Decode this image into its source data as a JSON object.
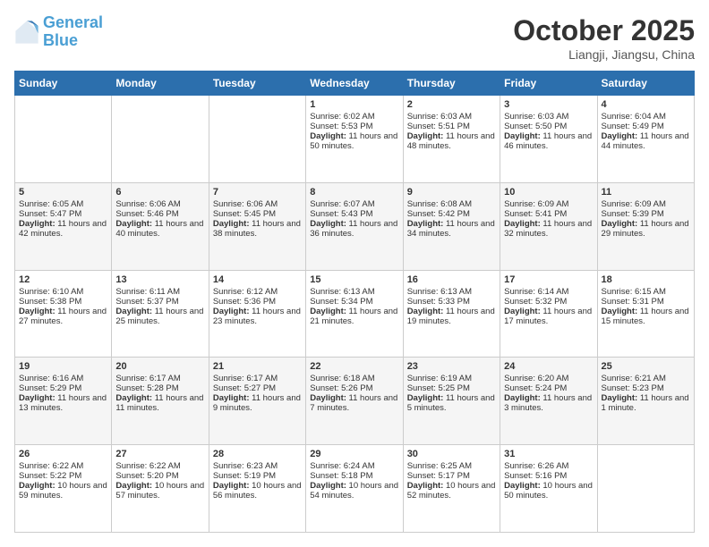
{
  "header": {
    "logo_line1": "General",
    "logo_line2": "Blue",
    "month": "October 2025",
    "location": "Liangji, Jiangsu, China"
  },
  "weekdays": [
    "Sunday",
    "Monday",
    "Tuesday",
    "Wednesday",
    "Thursday",
    "Friday",
    "Saturday"
  ],
  "weeks": [
    [
      {
        "day": "",
        "text": ""
      },
      {
        "day": "",
        "text": ""
      },
      {
        "day": "",
        "text": ""
      },
      {
        "day": "1",
        "text": "Sunrise: 6:02 AM\nSunset: 5:53 PM\nDaylight: 11 hours and 50 minutes."
      },
      {
        "day": "2",
        "text": "Sunrise: 6:03 AM\nSunset: 5:51 PM\nDaylight: 11 hours and 48 minutes."
      },
      {
        "day": "3",
        "text": "Sunrise: 6:03 AM\nSunset: 5:50 PM\nDaylight: 11 hours and 46 minutes."
      },
      {
        "day": "4",
        "text": "Sunrise: 6:04 AM\nSunset: 5:49 PM\nDaylight: 11 hours and 44 minutes."
      }
    ],
    [
      {
        "day": "5",
        "text": "Sunrise: 6:05 AM\nSunset: 5:47 PM\nDaylight: 11 hours and 42 minutes."
      },
      {
        "day": "6",
        "text": "Sunrise: 6:06 AM\nSunset: 5:46 PM\nDaylight: 11 hours and 40 minutes."
      },
      {
        "day": "7",
        "text": "Sunrise: 6:06 AM\nSunset: 5:45 PM\nDaylight: 11 hours and 38 minutes."
      },
      {
        "day": "8",
        "text": "Sunrise: 6:07 AM\nSunset: 5:43 PM\nDaylight: 11 hours and 36 minutes."
      },
      {
        "day": "9",
        "text": "Sunrise: 6:08 AM\nSunset: 5:42 PM\nDaylight: 11 hours and 34 minutes."
      },
      {
        "day": "10",
        "text": "Sunrise: 6:09 AM\nSunset: 5:41 PM\nDaylight: 11 hours and 32 minutes."
      },
      {
        "day": "11",
        "text": "Sunrise: 6:09 AM\nSunset: 5:39 PM\nDaylight: 11 hours and 29 minutes."
      }
    ],
    [
      {
        "day": "12",
        "text": "Sunrise: 6:10 AM\nSunset: 5:38 PM\nDaylight: 11 hours and 27 minutes."
      },
      {
        "day": "13",
        "text": "Sunrise: 6:11 AM\nSunset: 5:37 PM\nDaylight: 11 hours and 25 minutes."
      },
      {
        "day": "14",
        "text": "Sunrise: 6:12 AM\nSunset: 5:36 PM\nDaylight: 11 hours and 23 minutes."
      },
      {
        "day": "15",
        "text": "Sunrise: 6:13 AM\nSunset: 5:34 PM\nDaylight: 11 hours and 21 minutes."
      },
      {
        "day": "16",
        "text": "Sunrise: 6:13 AM\nSunset: 5:33 PM\nDaylight: 11 hours and 19 minutes."
      },
      {
        "day": "17",
        "text": "Sunrise: 6:14 AM\nSunset: 5:32 PM\nDaylight: 11 hours and 17 minutes."
      },
      {
        "day": "18",
        "text": "Sunrise: 6:15 AM\nSunset: 5:31 PM\nDaylight: 11 hours and 15 minutes."
      }
    ],
    [
      {
        "day": "19",
        "text": "Sunrise: 6:16 AM\nSunset: 5:29 PM\nDaylight: 11 hours and 13 minutes."
      },
      {
        "day": "20",
        "text": "Sunrise: 6:17 AM\nSunset: 5:28 PM\nDaylight: 11 hours and 11 minutes."
      },
      {
        "day": "21",
        "text": "Sunrise: 6:17 AM\nSunset: 5:27 PM\nDaylight: 11 hours and 9 minutes."
      },
      {
        "day": "22",
        "text": "Sunrise: 6:18 AM\nSunset: 5:26 PM\nDaylight: 11 hours and 7 minutes."
      },
      {
        "day": "23",
        "text": "Sunrise: 6:19 AM\nSunset: 5:25 PM\nDaylight: 11 hours and 5 minutes."
      },
      {
        "day": "24",
        "text": "Sunrise: 6:20 AM\nSunset: 5:24 PM\nDaylight: 11 hours and 3 minutes."
      },
      {
        "day": "25",
        "text": "Sunrise: 6:21 AM\nSunset: 5:23 PM\nDaylight: 11 hours and 1 minute."
      }
    ],
    [
      {
        "day": "26",
        "text": "Sunrise: 6:22 AM\nSunset: 5:22 PM\nDaylight: 10 hours and 59 minutes."
      },
      {
        "day": "27",
        "text": "Sunrise: 6:22 AM\nSunset: 5:20 PM\nDaylight: 10 hours and 57 minutes."
      },
      {
        "day": "28",
        "text": "Sunrise: 6:23 AM\nSunset: 5:19 PM\nDaylight: 10 hours and 56 minutes."
      },
      {
        "day": "29",
        "text": "Sunrise: 6:24 AM\nSunset: 5:18 PM\nDaylight: 10 hours and 54 minutes."
      },
      {
        "day": "30",
        "text": "Sunrise: 6:25 AM\nSunset: 5:17 PM\nDaylight: 10 hours and 52 minutes."
      },
      {
        "day": "31",
        "text": "Sunrise: 6:26 AM\nSunset: 5:16 PM\nDaylight: 10 hours and 50 minutes."
      },
      {
        "day": "",
        "text": ""
      }
    ]
  ]
}
